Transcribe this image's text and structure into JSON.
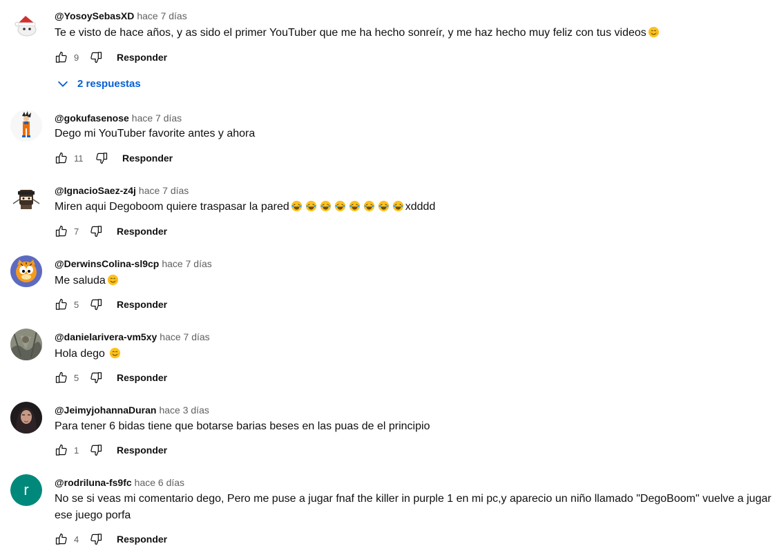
{
  "comments": [
    {
      "author": "@YosoySebasXD",
      "time": "hace 7 días",
      "text": "Te e visto de hace años, y as sido el primer YouTuber que me ha hecho sonreír, y me haz hecho muy feliz con tus videos",
      "likes": "9",
      "reply_label": "Responder",
      "replies_label": "2 respuestas",
      "avatar": "white-character-with-santa-hat"
    },
    {
      "author": "@gokufasenose",
      "time": "hace 7 días",
      "text": "Dego mi YouTuber favorite antes y ahora",
      "likes": "11",
      "reply_label": "Responder",
      "avatar": "goku-figure"
    },
    {
      "author": "@IgnacioSaez-z4j",
      "time": "hace 7 días",
      "text": "Miren aqui Degoboom quiere traspasar la pared",
      "text_suffix": "xdddd",
      "likes": "7",
      "reply_label": "Responder",
      "avatar": "ninja-character"
    },
    {
      "author": "@DerwinsColina-sl9cp",
      "time": "hace 7 días",
      "text": "Me saluda",
      "likes": "5",
      "reply_label": "Responder",
      "avatar": "garfield-cat"
    },
    {
      "author": "@danielarivera-vm5xy",
      "time": "hace 7 días",
      "text": "Hola dego",
      "likes": "5",
      "reply_label": "Responder",
      "avatar": "photo"
    },
    {
      "author": "@JeimyjohannaDuran",
      "time": "hace 3 días",
      "text": "Para tener 6 bidas tiene que  botarse barias beses en las puas de el principio",
      "likes": "1",
      "reply_label": "Responder",
      "avatar": "photo-person"
    },
    {
      "author": "@rodriluna-fs9fc",
      "time": "hace 6 días",
      "text": "No se si veas mi comentario dego, Pero me puse a jugar fnaf the killer in purple 1 en mi pc,y aparecio un niño llamado \"DegoBoom\" vuelve a jugar ese juego porfa",
      "likes": "4",
      "reply_label": "Responder",
      "avatar_letter": "r",
      "avatar_color": "#00897b"
    }
  ],
  "colors": {
    "link_blue": "#065fd4",
    "secondary_text": "#606060"
  }
}
